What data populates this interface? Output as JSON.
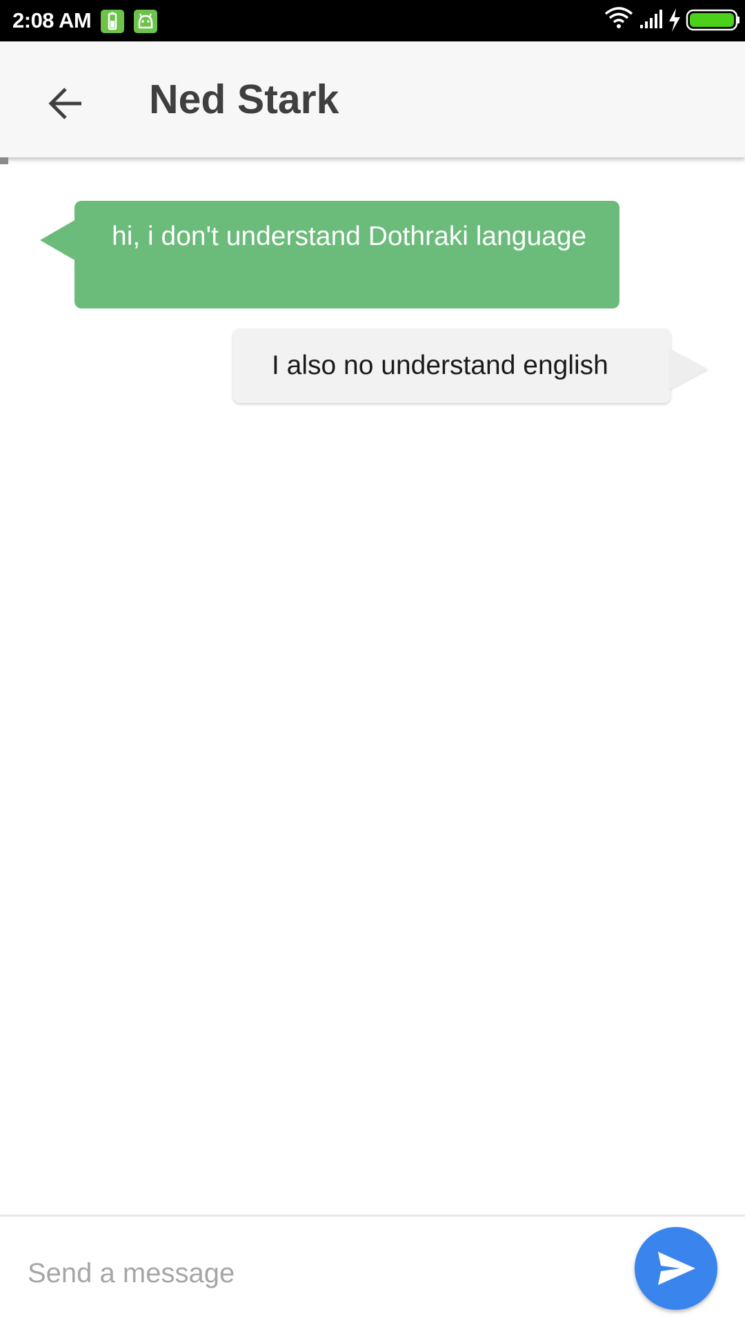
{
  "status_bar": {
    "time": "2:08 AM",
    "left_icons": [
      "battery-saver-icon",
      "android-icon"
    ],
    "right_icons": [
      "wifi-icon",
      "signal-icon",
      "charging-icon",
      "battery-icon"
    ],
    "battery_level": 1.0,
    "battery_color": "#4cd11a"
  },
  "app_bar": {
    "back_icon": "arrow-back-icon",
    "title": "Ned Stark"
  },
  "messages": [
    {
      "direction": "incoming",
      "text": "hi, i don't understand Dothraki language",
      "color": "#6bbb7a"
    },
    {
      "direction": "outgoing",
      "text": "I also no understand english",
      "color": "#f2f2f2"
    }
  ],
  "composer": {
    "placeholder": "Send a message",
    "value": "",
    "send_icon": "send-icon",
    "send_color": "#3a84ee"
  }
}
